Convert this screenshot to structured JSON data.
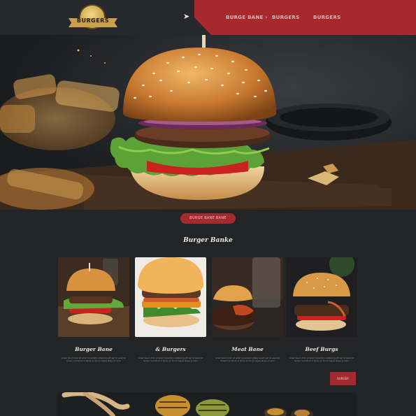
{
  "header": {
    "logo_text": "BURGERS",
    "nav": [
      {
        "label": "BURGE BANE",
        "has_caret": true
      },
      {
        "label": "BURGERS"
      },
      {
        "label": "BURGERS"
      }
    ]
  },
  "hero": {
    "cta_label": "BURGE BANE BANE"
  },
  "section": {
    "title": "Burger Banke"
  },
  "cards": [
    {
      "title": "Burger Bane",
      "desc": "Lorem ipsum dolor sit amet consectetur adipiscing elit sed do eiusmod tempor incididunt ut labore et dolore magna aliqua ut enim"
    },
    {
      "title": "& Burgers",
      "desc": "Lorem ipsum dolor sit amet consectetur adipiscing elit sed do eiusmod tempor incididunt ut labore et dolore magna aliqua ut enim"
    },
    {
      "title": "Meat Bane",
      "desc": "Lorem ipsum dolor sit amet consectetur adipiscing elit sed do eiusmod tempor incididunt ut labore et dolore magna aliqua ut enim"
    },
    {
      "title": "Beef Burgs",
      "desc": "Lorem ipsum dolor sit amet consectetur adipiscing elit sed do eiusmod tempor incididunt ut labore et dolore magna aliqua ut enim"
    }
  ],
  "more_button": "BURGER",
  "colors": {
    "accent_red": "#a8292c",
    "background": "#232426",
    "header": "#27282b",
    "gold": "#c9a14d"
  }
}
